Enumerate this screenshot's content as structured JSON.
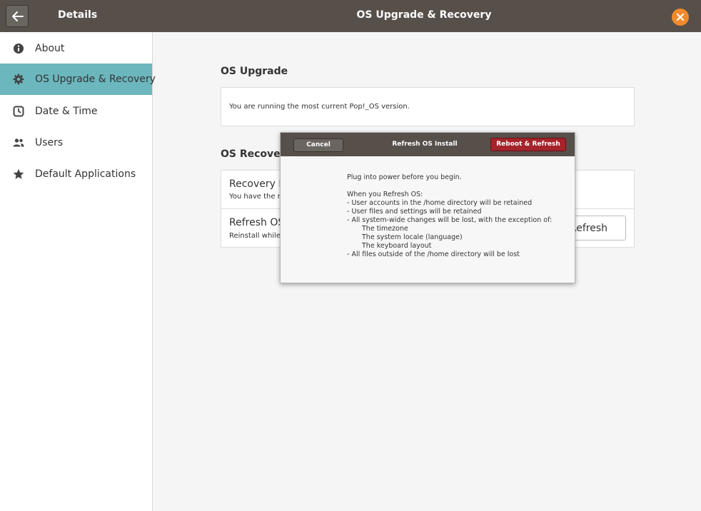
{
  "header": {
    "back_icon": "arrow-left-icon",
    "sidebar_title": "Details",
    "window_title": "OS Upgrade & Recovery",
    "close_icon": "close-icon",
    "accent": "#f28a2c"
  },
  "sidebar": {
    "selected_color": "#6cb7be",
    "items": [
      {
        "label": "About",
        "icon": "info-icon",
        "selected": false
      },
      {
        "label": "OS Upgrade & Recovery",
        "icon": "gear-icon",
        "selected": true
      },
      {
        "label": "Date & Time",
        "icon": "clock-icon",
        "selected": false
      },
      {
        "label": "Users",
        "icon": "users-icon",
        "selected": false
      },
      {
        "label": "Default Applications",
        "icon": "star-icon",
        "selected": false
      }
    ]
  },
  "main": {
    "upgrade": {
      "title": "OS Upgrade",
      "status": "You are running the most current Pop!_OS version."
    },
    "recovery": {
      "title": "OS Recovery",
      "partition_title": "Recovery Pa",
      "partition_sub": "You have the m",
      "refresh_title": "Refresh OS",
      "refresh_sub": "Reinstall while r",
      "refresh_button": "Refresh"
    }
  },
  "dialog": {
    "title": "Refresh OS Install",
    "cancel_label": "Cancel",
    "confirm_label": "Reboot & Refresh",
    "confirm_color": "#a5232a",
    "intro": "Plug into power before you begin.",
    "when_heading": "When you Refresh OS:",
    "lines": [
      "- User accounts in the /home directory will be retained",
      "- User files and settings will be retained",
      "- All system-wide changes will be lost, with the exception of:"
    ],
    "exceptions": [
      "The timezone",
      "The system locale (language)",
      "The keyboard layout"
    ],
    "final_line": "- All files outside of the /home directory will be lost"
  }
}
